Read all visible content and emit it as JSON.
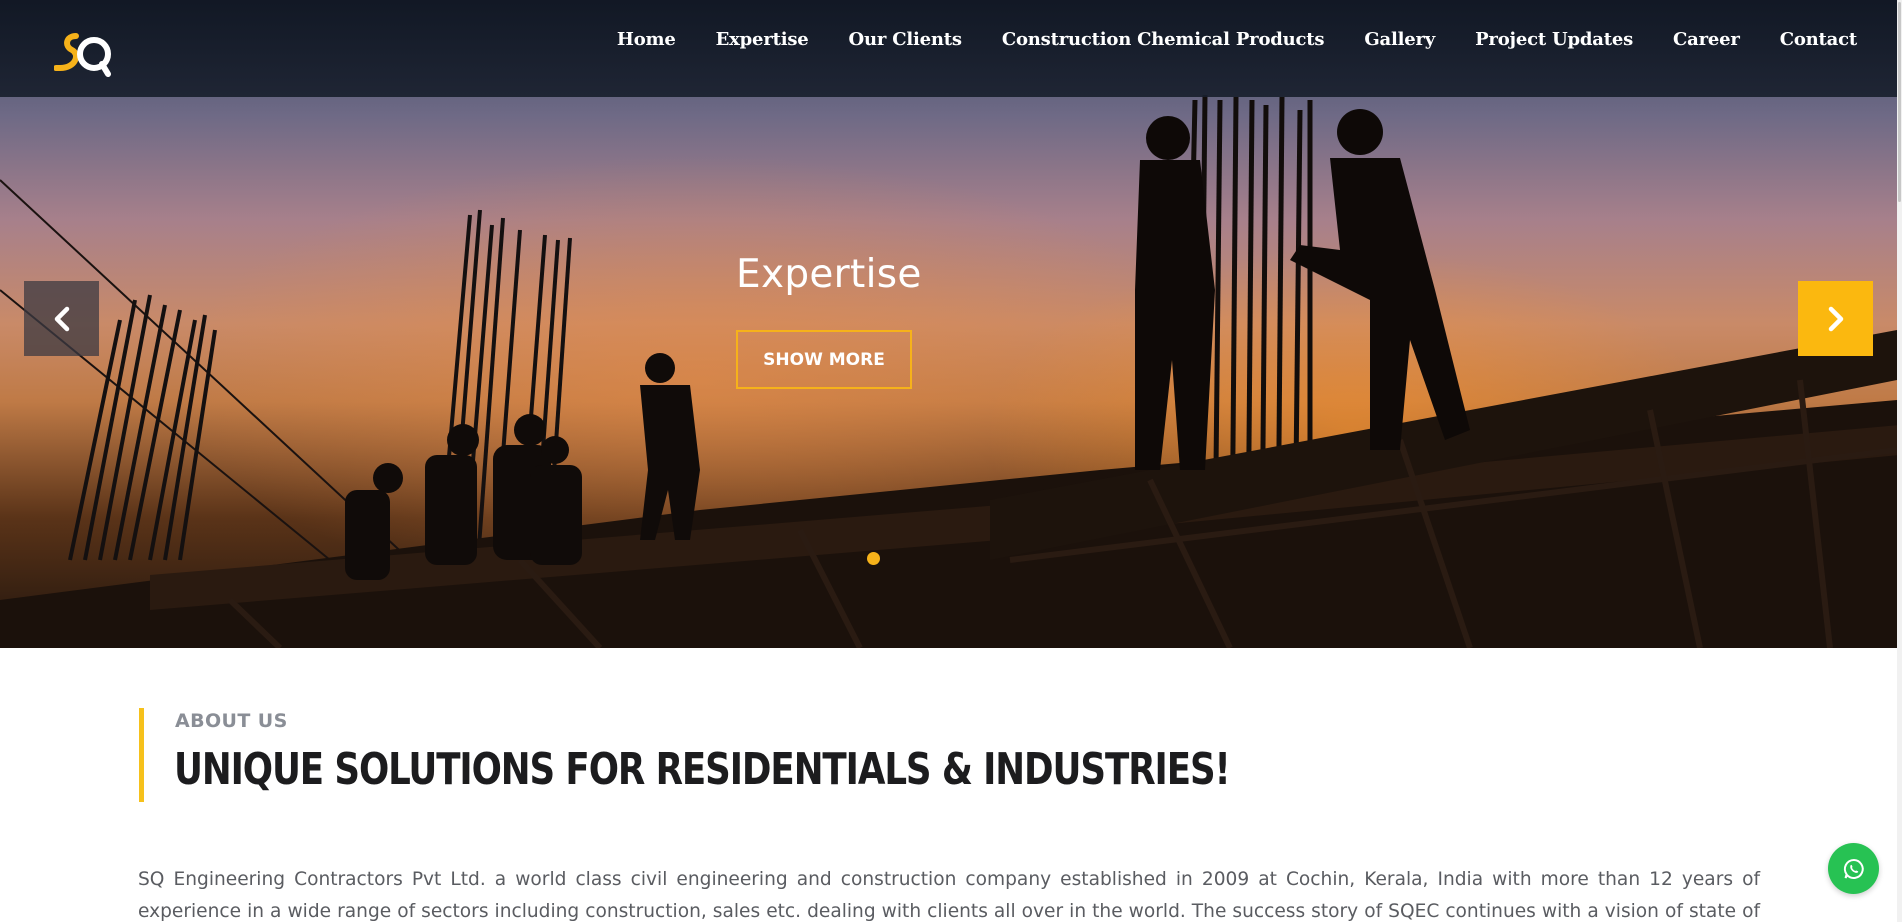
{
  "nav": {
    "items": [
      {
        "label": "Home"
      },
      {
        "label": "Expertise"
      },
      {
        "label": "Our Clients"
      },
      {
        "label": "Construction Chemical Products"
      },
      {
        "label": "Gallery"
      },
      {
        "label": "Project Updates"
      },
      {
        "label": "Career"
      },
      {
        "label": "Contact"
      }
    ]
  },
  "logo": {
    "text": "SQ",
    "icon": "sq-logo-icon"
  },
  "slider": {
    "title": "Expertise",
    "button_label": "SHOW MORE",
    "prev_icon": "chevron-left-icon",
    "next_icon": "chevron-right-icon",
    "active_dot": 1
  },
  "about": {
    "label": "ABOUT US",
    "heading": "UNIQUE SOLUTIONS FOR RESIDENTIALS & INDUSTRIES!",
    "paragraph": "SQ Engineering Contractors Pvt Ltd. a world class civil engineering and construction company established in 2009 at Cochin, Kerala, India with more than 12 years of experience in a wide range of sectors including construction, sales etc. dealing with clients all over in the world. The success story of SQEC continues with a vision of state of art technology, hard work with"
  },
  "whatsapp": {
    "icon": "whatsapp-icon"
  },
  "colors": {
    "accent": "#f6b21a",
    "next_arrow_bg": "#fbb80f",
    "whatsapp_green": "#27c253",
    "heading_dark": "#1c1c1e",
    "label_gray": "#8a8e96"
  }
}
